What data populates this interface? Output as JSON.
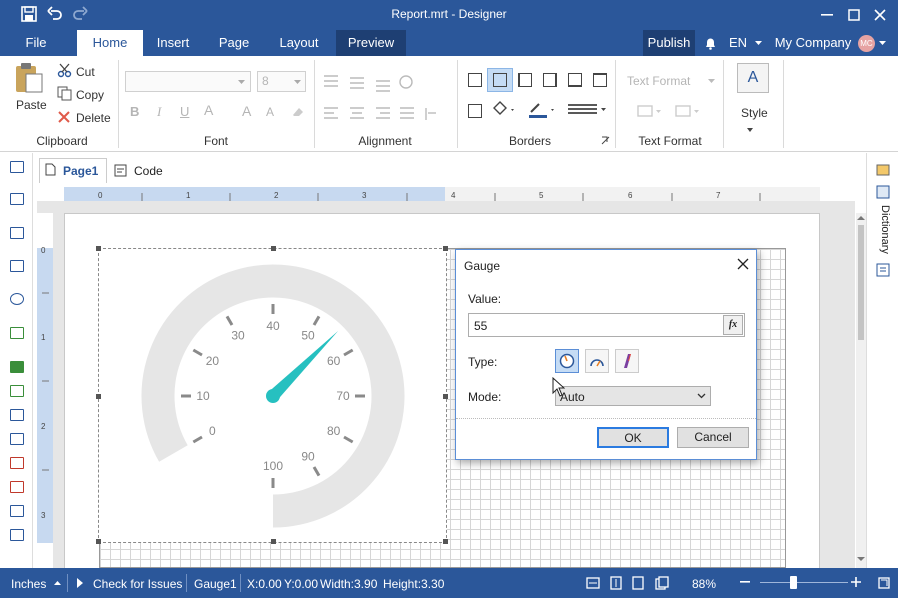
{
  "window": {
    "title": "Report.mrt - Designer"
  },
  "menu": {
    "tabs": [
      "File",
      "Home",
      "Insert",
      "Page",
      "Layout",
      "Preview"
    ],
    "publish": "Publish",
    "language": "EN",
    "company": "My Company",
    "avatar_initials": "MC"
  },
  "ribbon": {
    "clipboard": {
      "paste": "Paste",
      "cut": "Cut",
      "copy": "Copy",
      "delete": "Delete",
      "label": "Clipboard"
    },
    "font": {
      "size": "8",
      "label": "Font"
    },
    "alignment": {
      "label": "Alignment"
    },
    "borders": {
      "label": "Borders"
    },
    "text_format": {
      "format": "Text Format",
      "label": "Text Format"
    },
    "style": {
      "label": "Style"
    }
  },
  "doc_tabs": {
    "page1": "Page1",
    "code": "Code"
  },
  "ruler": {
    "h_labels": [
      "0",
      "1",
      "2",
      "3",
      "4",
      "5",
      "6",
      "7"
    ],
    "v_labels": [
      "0",
      "1",
      "2",
      "3"
    ]
  },
  "gauge": {
    "ticks": [
      "0",
      "10",
      "20",
      "30",
      "40",
      "50",
      "60",
      "70",
      "80",
      "90",
      "100"
    ],
    "value": 55,
    "min": 0,
    "max": 100,
    "needle_color": "#26c0c0",
    "ring_color": "#e6e6e6"
  },
  "right_panel": {
    "dictionary": "Dictionary"
  },
  "dialog": {
    "title": "Gauge",
    "value_label": "Value:",
    "value": "55",
    "fx": "fx",
    "type_label": "Type:",
    "mode_label": "Mode:",
    "mode_value": "Auto",
    "ok": "OK",
    "cancel": "Cancel"
  },
  "status": {
    "units": "Inches",
    "check": "Check for Issues",
    "component": "Gauge1",
    "x": "X:0.00",
    "y": "Y:0.00",
    "width": "Width:3.90",
    "height": "Height:3.30",
    "zoom": "88%"
  },
  "colors": {
    "brand": "#2b579a",
    "accent": "#1e3f73"
  }
}
